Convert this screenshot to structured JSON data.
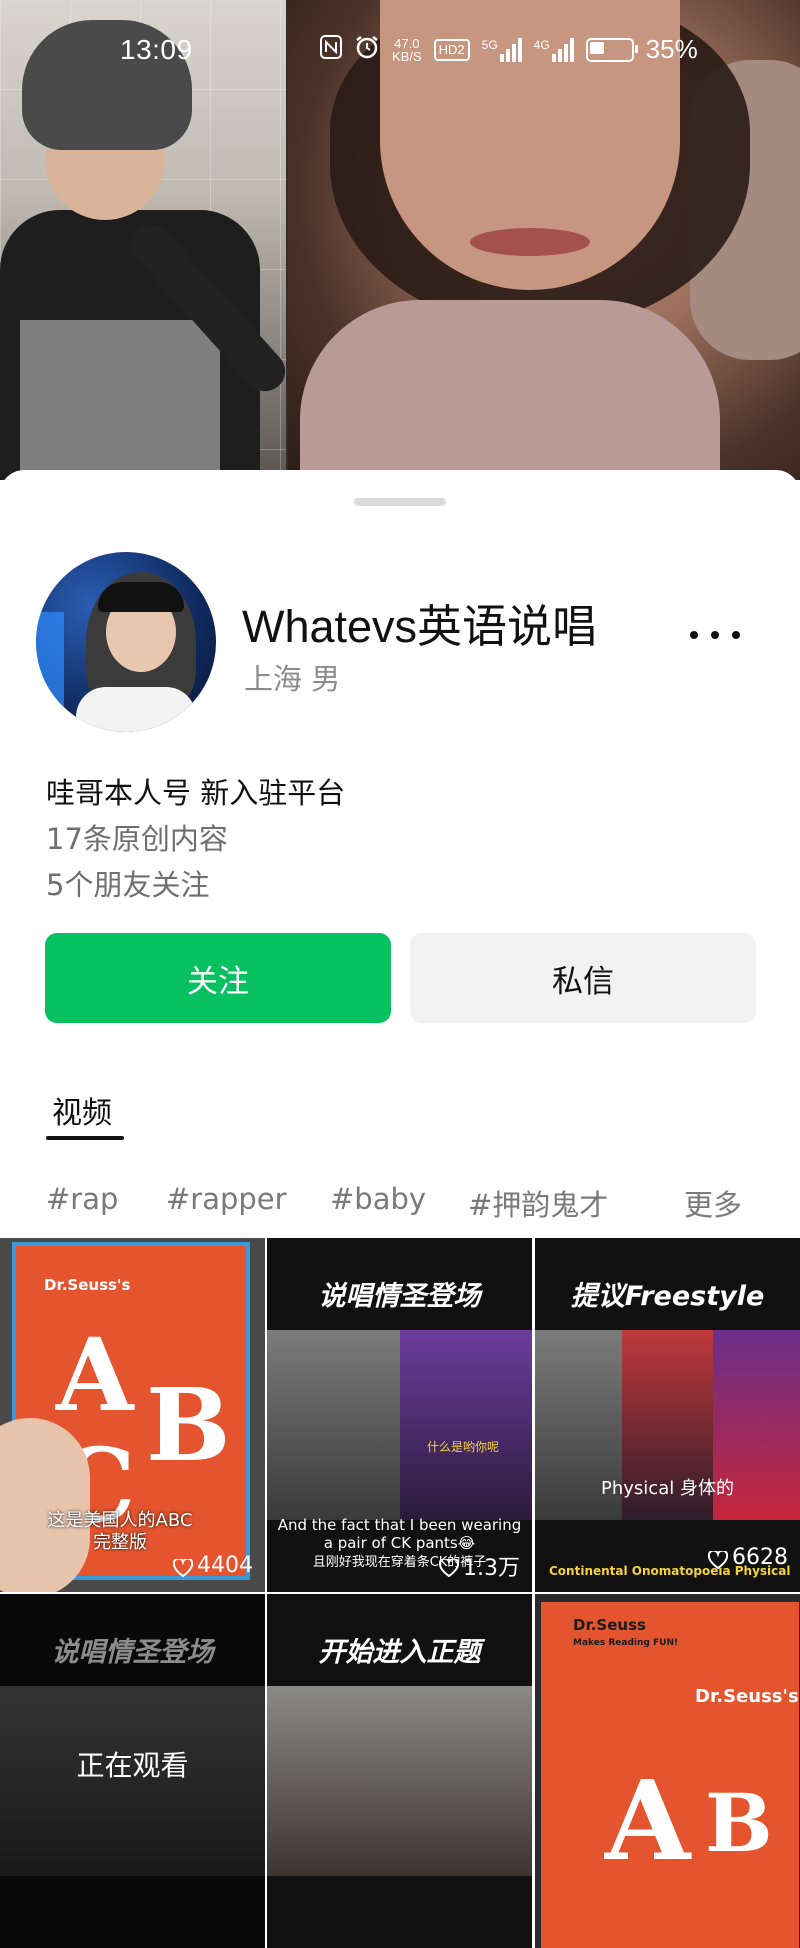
{
  "status_bar": {
    "time": "13:09",
    "speed_value": "47.0",
    "speed_unit": "KB/S",
    "hd_badge": "HD2",
    "network1": "5G",
    "network2": "4G",
    "battery_percent": "35%",
    "battery_level": 0.35,
    "icons": [
      "nfc-icon",
      "alarm-icon",
      "hd-voice-icon",
      "signal-5g-icon",
      "signal-4g-icon",
      "battery-icon"
    ]
  },
  "profile": {
    "name": "Whatevs英语说唱",
    "location_gender": "上海 男",
    "bio": "哇哥本人号 新入驻平台",
    "original_count": "17条原创内容",
    "friends_follow": "5个朋友关注"
  },
  "actions": {
    "follow_label": "关注",
    "message_label": "私信",
    "follow_color": "#07c160"
  },
  "tabs": {
    "videos_label": "视频"
  },
  "tags": [
    "#rap",
    "#rapper",
    "#baby",
    "#押韵鬼才",
    "更多"
  ],
  "videos": [
    {
      "title": "",
      "caption": "这是美国人的ABC\n完整版",
      "likes": "4404",
      "book_brand": "Dr.Seuss's",
      "letters": [
        "A",
        "B",
        "C"
      ]
    },
    {
      "title": "说唱情圣登场",
      "subtitle_en": "And the fact that I been wearing\na pair of CK pants😂",
      "subtitle_zh": "且刚好我现在穿着条CK的裤子",
      "overlay_text": "什么是哟你呢",
      "likes": "1.3万"
    },
    {
      "title": "提议Freestyle",
      "caption": "Physical 身体的",
      "keywords": "Continental  Onomatopoeia  Physical",
      "likes": "6628"
    },
    {
      "title": "说唱情圣登场",
      "watching_label": "正在观看"
    },
    {
      "title": "开始进入正题"
    },
    {
      "book_brand": "Dr.Seuss",
      "book_tag": "Makes Reading FUN!",
      "book_title": "Dr.Seuss's",
      "letters": [
        "A",
        "B"
      ]
    }
  ]
}
